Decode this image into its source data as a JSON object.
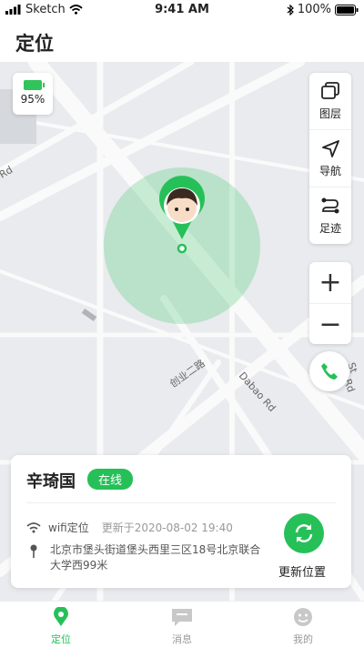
{
  "statusbar": {
    "carrier": "Sketch",
    "time": "9:41 AM",
    "battery": "100%"
  },
  "header": {
    "title": "定位"
  },
  "map": {
    "battery_percent": "95%",
    "tools": [
      {
        "label": "图层",
        "icon": "layers-icon"
      },
      {
        "label": "导航",
        "icon": "navigate-icon"
      },
      {
        "label": "足迹",
        "icon": "route-icon"
      }
    ],
    "zoom_in": "+",
    "zoom_out": "−",
    "road_labels": [
      "创业二路",
      "Dabao Rd",
      "Rd",
      "Rd",
      "St"
    ],
    "accent": "#26c058"
  },
  "card": {
    "name": "辛琦国",
    "status": "在线",
    "location_type": "wifi定位",
    "updated": "更新于2020-08-02 19:40",
    "address": "北京市堡头街道堡头西里三区18号北京联合大学西99米",
    "refresh_label": "更新位置"
  },
  "tabs": [
    {
      "label": "定位",
      "icon": "location-icon",
      "active": true
    },
    {
      "label": "消息",
      "icon": "message-icon",
      "active": false
    },
    {
      "label": "我的",
      "icon": "profile-icon",
      "active": false
    }
  ]
}
